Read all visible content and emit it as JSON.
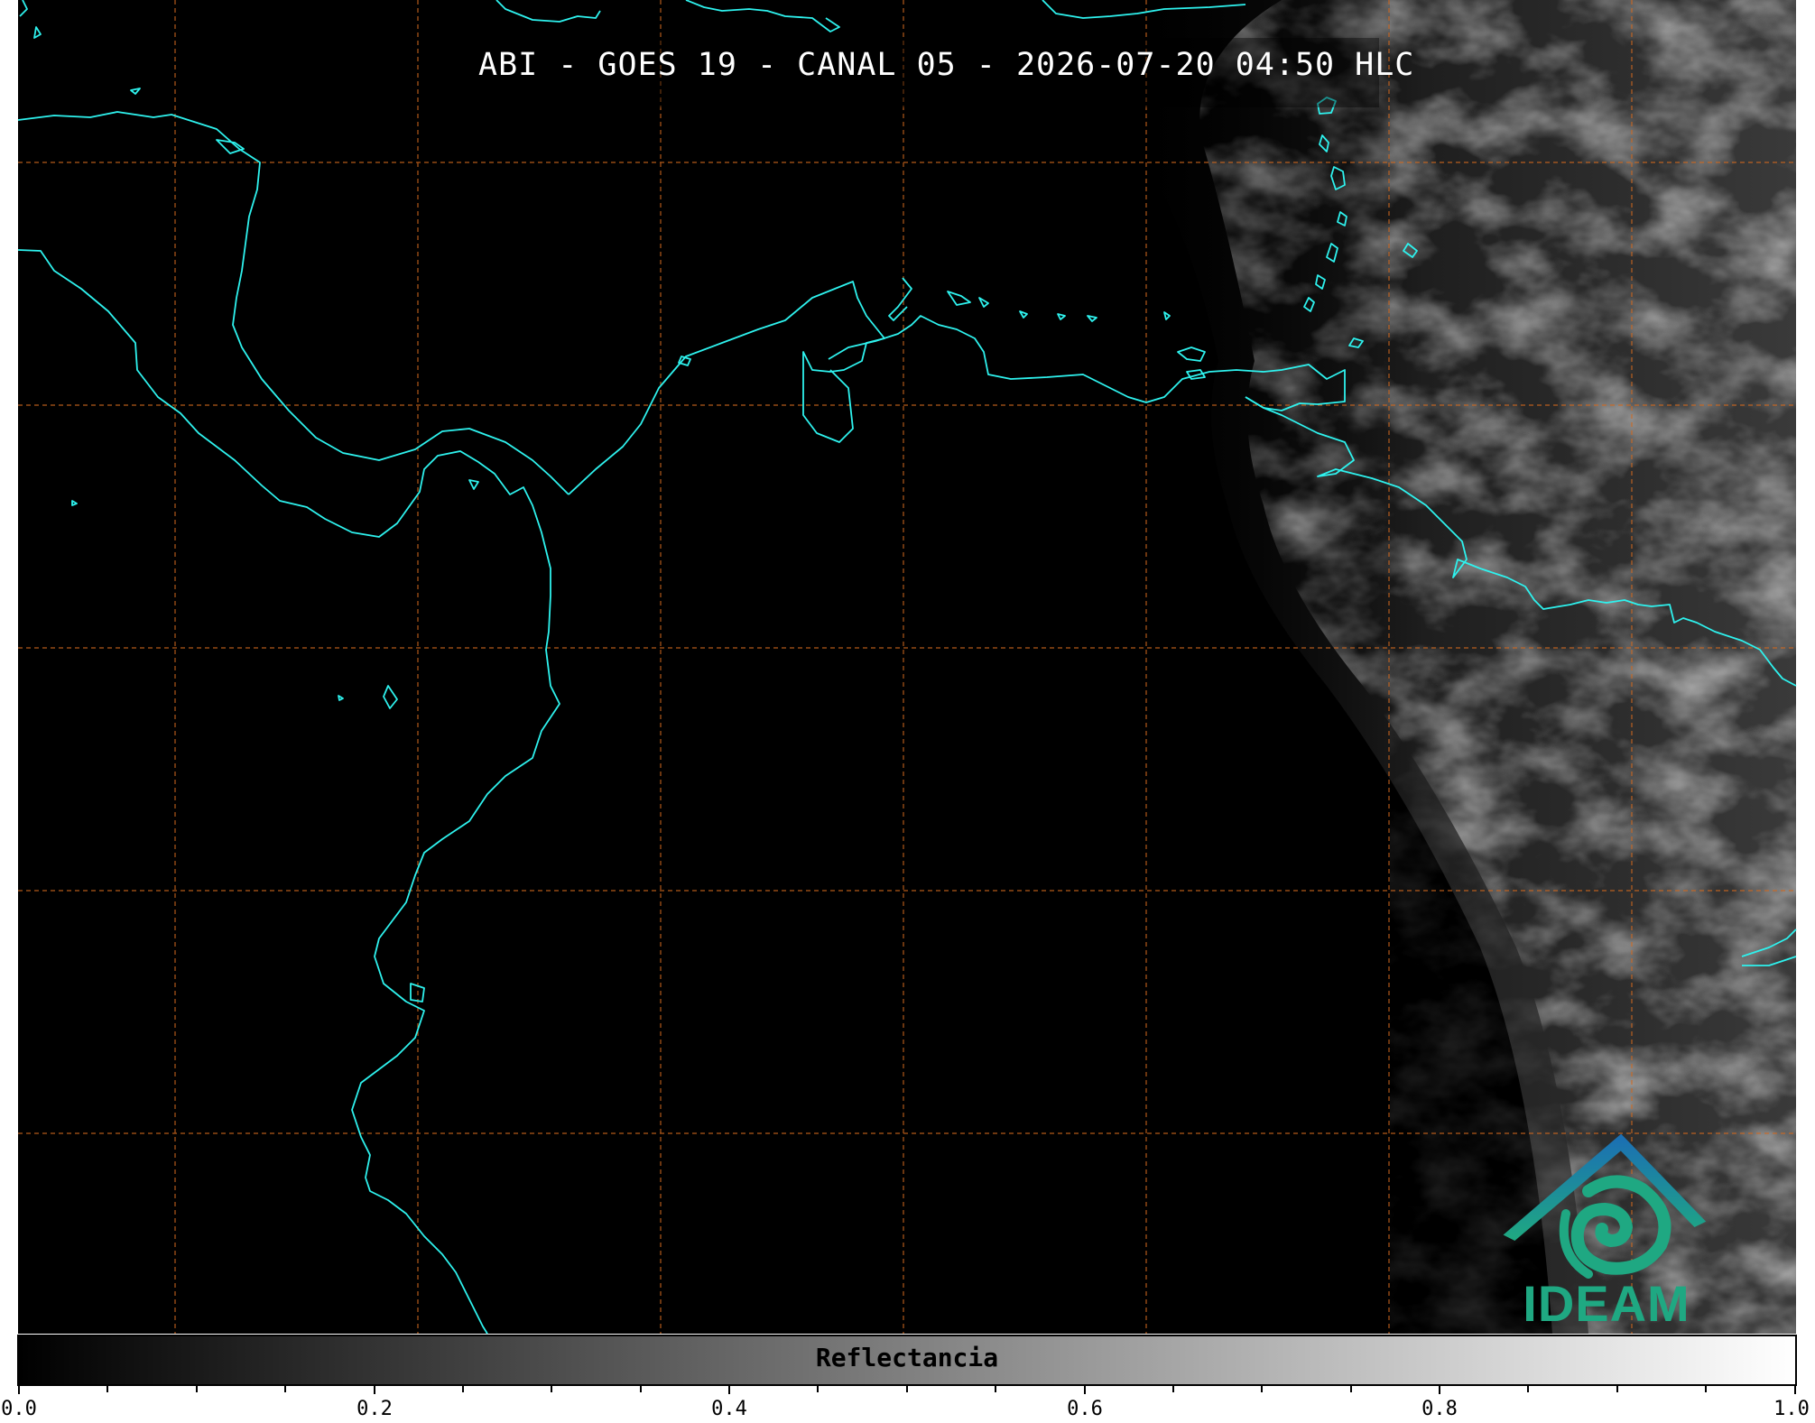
{
  "title": "ABI - GOES 19 - CANAL 05 - 2026-07-20 04:50 HLC",
  "colorbar": {
    "label": "Reflectancia",
    "ticks": [
      "0.0",
      "0.2",
      "0.4",
      "0.6",
      "0.8",
      "1.0"
    ],
    "range": [
      0.0,
      1.0
    ],
    "colormap": "grayscale"
  },
  "logo": {
    "text": "IDEAM"
  },
  "colors": {
    "coastline": "#2ef2ee",
    "gridline": "#d2691e",
    "background": "#000000",
    "logo_blue": "#1b78b4",
    "logo_green": "#1fa882"
  },
  "map": {
    "gridlines": "dashed",
    "coastlines": true
  }
}
